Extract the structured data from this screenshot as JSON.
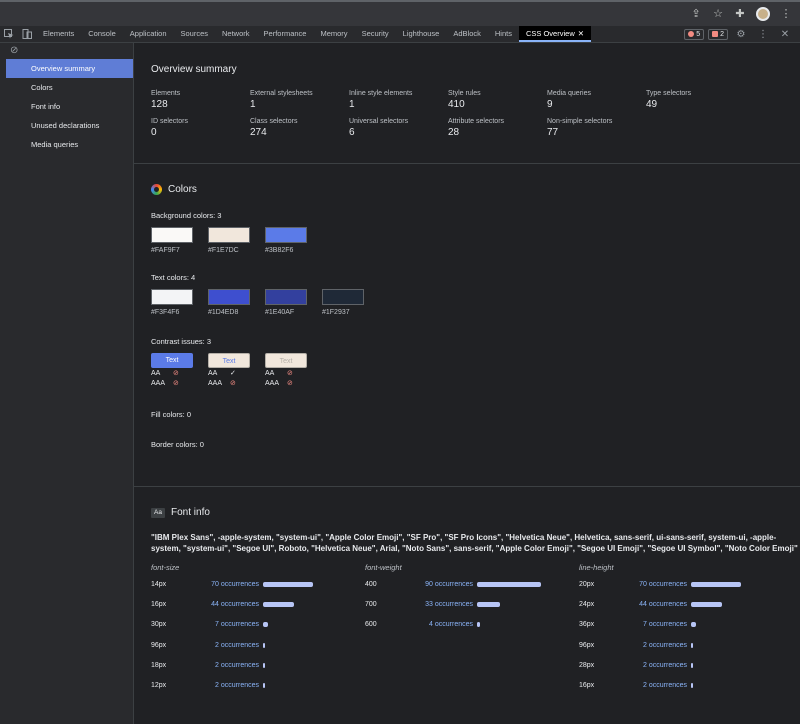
{
  "devtools": {
    "tabs": [
      "Elements",
      "Console",
      "Application",
      "Sources",
      "Network",
      "Performance",
      "Memory",
      "Security",
      "Lighthouse",
      "AdBlock",
      "Hints",
      "CSS Overview"
    ],
    "active_tab": "CSS Overview",
    "error_count": "5",
    "issue_count": "2"
  },
  "sidebar": {
    "items": [
      "Overview summary",
      "Colors",
      "Font info",
      "Unused declarations",
      "Media queries"
    ],
    "active": "Overview summary"
  },
  "overview": {
    "title": "Overview summary",
    "stats": [
      {
        "label": "Elements",
        "value": "128"
      },
      {
        "label": "External stylesheets",
        "value": "1"
      },
      {
        "label": "Inline style elements",
        "value": "1"
      },
      {
        "label": "Style rules",
        "value": "410"
      },
      {
        "label": "Media queries",
        "value": "9"
      },
      {
        "label": "Type selectors",
        "value": "49"
      },
      {
        "label": "ID selectors",
        "value": "0"
      },
      {
        "label": "Class selectors",
        "value": "274"
      },
      {
        "label": "Universal selectors",
        "value": "6"
      },
      {
        "label": "Attribute selectors",
        "value": "28"
      },
      {
        "label": "Non-simple selectors",
        "value": "77"
      }
    ]
  },
  "colors": {
    "title": "Colors",
    "background_label": "Background colors: 3",
    "background": [
      "#FAF9F7",
      "#F1E7DC",
      "#3B82F6"
    ],
    "background_swatch": [
      "#FAF9F7",
      "#F1E7DC",
      "#5B7BE8"
    ],
    "text_label": "Text colors: 4",
    "text": [
      "#F3F4F6",
      "#1D4ED8",
      "#1E40AF",
      "#1F2937"
    ],
    "text_swatch": [
      "#F3F4F6",
      "#3E4FCF",
      "#33409E",
      "#1F2937"
    ],
    "contrast_label": "Contrast issues: 3",
    "contrast": [
      {
        "text": "Text",
        "bg": "#5B7BE8",
        "fg": "#ffffff",
        "aa": "fail",
        "aaa": "fail"
      },
      {
        "text": "Text",
        "bg": "#F1E7DC",
        "fg": "#5B7BE8",
        "aa": "pass",
        "aaa": "fail"
      },
      {
        "text": "Text",
        "bg": "#F1E7DC",
        "fg": "#b5b0a8",
        "aa": "fail",
        "aaa": "fail"
      }
    ],
    "aa_label": "AA",
    "aaa_label": "AAA",
    "fill_label": "Fill colors: 0",
    "border_label": "Border colors: 0"
  },
  "fontinfo": {
    "title": "Font info",
    "icon_text": "Aa",
    "families": "\"IBM Plex Sans\", -apple-system, \"system-ui\", \"Apple Color Emoji\", \"SF Pro\", \"SF Pro Icons\", \"Helvetica Neue\", Helvetica, sans-serif, ui-sans-serif, system-ui, -apple-system, \"system-ui\", \"Segoe UI\", Roboto, \"Helvetica Neue\", Arial, \"Noto Sans\", sans-serif, \"Apple Color Emoji\", \"Segoe UI Emoji\", \"Segoe UI Symbol\", \"Noto Color Emoji\"",
    "metrics": [
      {
        "heading": "font-size",
        "rows": [
          {
            "key": "14px",
            "occ": "70 occurrences",
            "count": 70
          },
          {
            "key": "16px",
            "occ": "44 occurrences",
            "count": 44
          },
          {
            "key": "30px",
            "occ": "7 occurrences",
            "count": 7
          },
          {
            "key": "96px",
            "occ": "2 occurrences",
            "count": 2
          },
          {
            "key": "18px",
            "occ": "2 occurrences",
            "count": 2
          },
          {
            "key": "12px",
            "occ": "2 occurrences",
            "count": 2
          }
        ]
      },
      {
        "heading": "font-weight",
        "rows": [
          {
            "key": "400",
            "occ": "90 occurrences",
            "count": 90
          },
          {
            "key": "700",
            "occ": "33 occurrences",
            "count": 33
          },
          {
            "key": "600",
            "occ": "4 occurrences",
            "count": 4
          }
        ]
      },
      {
        "heading": "line-height",
        "rows": [
          {
            "key": "20px",
            "occ": "70 occurrences",
            "count": 70
          },
          {
            "key": "24px",
            "occ": "44 occurrences",
            "count": 44
          },
          {
            "key": "36px",
            "occ": "7 occurrences",
            "count": 7
          },
          {
            "key": "96px",
            "occ": "2 occurrences",
            "count": 2
          },
          {
            "key": "28px",
            "occ": "2 occurrences",
            "count": 2
          },
          {
            "key": "16px",
            "occ": "2 occurrences",
            "count": 2
          }
        ]
      }
    ]
  }
}
